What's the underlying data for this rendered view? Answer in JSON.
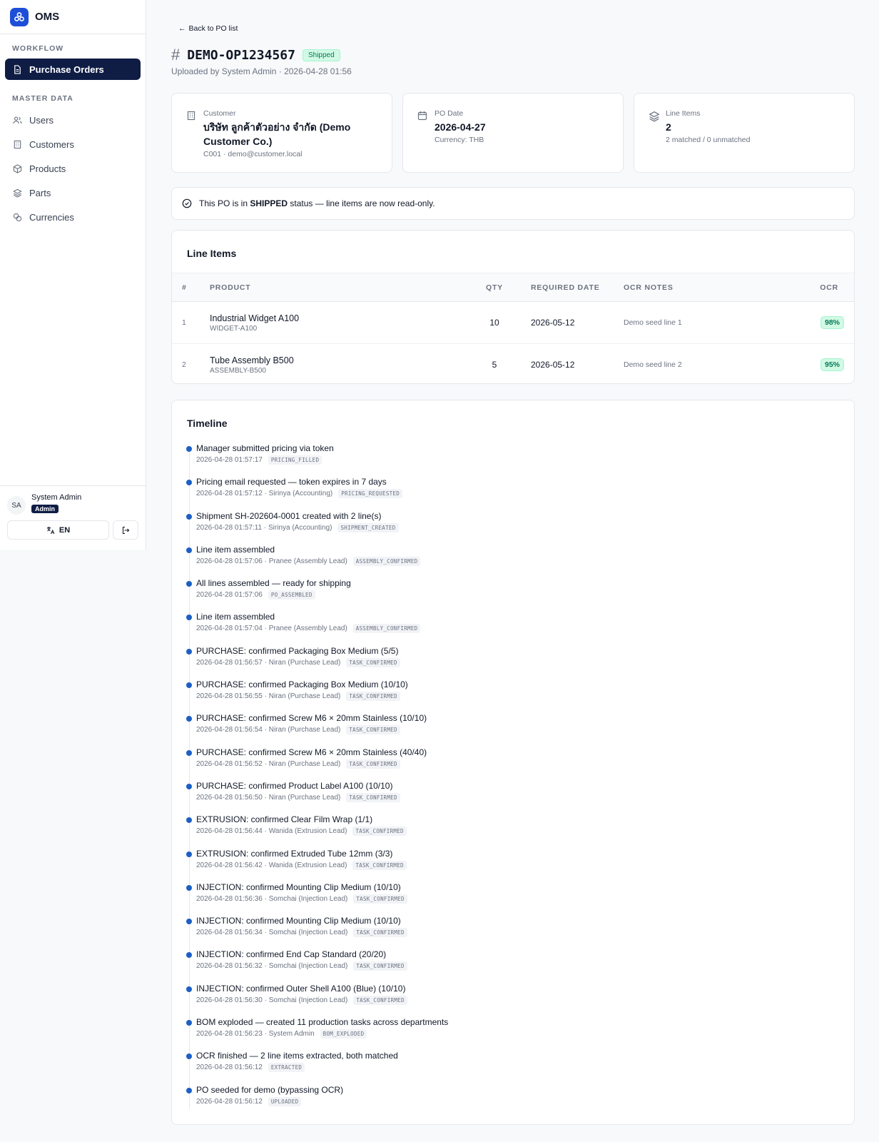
{
  "app": {
    "name": "OMS"
  },
  "sidebar": {
    "workflow_label": "WORKFLOW",
    "workflow_items": [
      {
        "label": "Purchase Orders",
        "icon": "file-icon"
      }
    ],
    "master_label": "MASTER DATA",
    "master_items": [
      {
        "label": "Users",
        "icon": "users-icon"
      },
      {
        "label": "Customers",
        "icon": "building-icon"
      },
      {
        "label": "Products",
        "icon": "box-icon"
      },
      {
        "label": "Parts",
        "icon": "layers-icon"
      },
      {
        "label": "Currencies",
        "icon": "coins-icon"
      }
    ],
    "user": {
      "initials": "SA",
      "name": "System Admin",
      "role": "Admin"
    },
    "lang": "EN"
  },
  "header": {
    "back_label": "Back to PO list",
    "po_number": "DEMO-OP1234567",
    "status": "Shipped",
    "uploaded": "Uploaded by System Admin · 2026-04-28 01:56"
  },
  "cards": {
    "customer": {
      "label": "Customer",
      "value": "บริษัท ลูกค้าตัวอย่าง จำกัด (Demo Customer Co.)",
      "sub": "C001 · demo@customer.local"
    },
    "po_date": {
      "label": "PO Date",
      "value": "2026-04-27",
      "sub": "Currency: THB"
    },
    "line_items": {
      "label": "Line Items",
      "value": "2",
      "sub": "2 matched / 0 unmatched"
    }
  },
  "alert": {
    "prefix": "This PO is in ",
    "status": "SHIPPED",
    "suffix": " status — line items are now read-only."
  },
  "line_items": {
    "title": "Line Items",
    "columns": [
      "#",
      "PRODUCT",
      "QTY",
      "REQUIRED DATE",
      "OCR NOTES",
      "OCR"
    ],
    "rows": [
      {
        "num": "1",
        "name": "Industrial Widget A100",
        "sku": "WIDGET-A100",
        "qty": "10",
        "date": "2026-05-12",
        "notes": "Demo seed line 1",
        "ocr": "98%"
      },
      {
        "num": "2",
        "name": "Tube Assembly B500",
        "sku": "ASSEMBLY-B500",
        "qty": "5",
        "date": "2026-05-12",
        "notes": "Demo seed line 2",
        "ocr": "95%"
      }
    ]
  },
  "timeline": {
    "title": "Timeline",
    "events": [
      {
        "text": "Manager submitted pricing via token",
        "meta": "2026-04-28 01:57:17",
        "code": "PRICING_FILLED"
      },
      {
        "text": "Pricing email requested — token expires in 7 days",
        "meta": "2026-04-28 01:57:12 · Sirinya (Accounting)",
        "code": "PRICING_REQUESTED"
      },
      {
        "text": "Shipment SH-202604-0001 created with 2 line(s)",
        "meta": "2026-04-28 01:57:11 · Sirinya (Accounting)",
        "code": "SHIPMENT_CREATED"
      },
      {
        "text": "Line item assembled",
        "meta": "2026-04-28 01:57:06 · Pranee (Assembly Lead)",
        "code": "ASSEMBLY_CONFIRMED"
      },
      {
        "text": "All lines assembled — ready for shipping",
        "meta": "2026-04-28 01:57:06",
        "code": "PO_ASSEMBLED"
      },
      {
        "text": "Line item assembled",
        "meta": "2026-04-28 01:57:04 · Pranee (Assembly Lead)",
        "code": "ASSEMBLY_CONFIRMED"
      },
      {
        "text": "PURCHASE: confirmed Packaging Box Medium (5/5)",
        "meta": "2026-04-28 01:56:57 · Niran (Purchase Lead)",
        "code": "TASK_CONFIRMED"
      },
      {
        "text": "PURCHASE: confirmed Packaging Box Medium (10/10)",
        "meta": "2026-04-28 01:56:55 · Niran (Purchase Lead)",
        "code": "TASK_CONFIRMED"
      },
      {
        "text": "PURCHASE: confirmed Screw M6 × 20mm Stainless (10/10)",
        "meta": "2026-04-28 01:56:54 · Niran (Purchase Lead)",
        "code": "TASK_CONFIRMED"
      },
      {
        "text": "PURCHASE: confirmed Screw M6 × 20mm Stainless (40/40)",
        "meta": "2026-04-28 01:56:52 · Niran (Purchase Lead)",
        "code": "TASK_CONFIRMED"
      },
      {
        "text": "PURCHASE: confirmed Product Label A100 (10/10)",
        "meta": "2026-04-28 01:56:50 · Niran (Purchase Lead)",
        "code": "TASK_CONFIRMED"
      },
      {
        "text": "EXTRUSION: confirmed Clear Film Wrap (1/1)",
        "meta": "2026-04-28 01:56:44 · Wanida (Extrusion Lead)",
        "code": "TASK_CONFIRMED"
      },
      {
        "text": "EXTRUSION: confirmed Extruded Tube 12mm (3/3)",
        "meta": "2026-04-28 01:56:42 · Wanida (Extrusion Lead)",
        "code": "TASK_CONFIRMED"
      },
      {
        "text": "INJECTION: confirmed Mounting Clip Medium (10/10)",
        "meta": "2026-04-28 01:56:36 · Somchai (Injection Lead)",
        "code": "TASK_CONFIRMED"
      },
      {
        "text": "INJECTION: confirmed Mounting Clip Medium (10/10)",
        "meta": "2026-04-28 01:56:34 · Somchai (Injection Lead)",
        "code": "TASK_CONFIRMED"
      },
      {
        "text": "INJECTION: confirmed End Cap Standard (20/20)",
        "meta": "2026-04-28 01:56:32 · Somchai (Injection Lead)",
        "code": "TASK_CONFIRMED"
      },
      {
        "text": "INJECTION: confirmed Outer Shell A100 (Blue) (10/10)",
        "meta": "2026-04-28 01:56:30 · Somchai (Injection Lead)",
        "code": "TASK_CONFIRMED"
      },
      {
        "text": "BOM exploded — created 11 production tasks across departments",
        "meta": "2026-04-28 01:56:23 · System Admin",
        "code": "BOM_EXPLODED"
      },
      {
        "text": "OCR finished — 2 line items extracted, both matched",
        "meta": "2026-04-28 01:56:12",
        "code": "EXTRACTED"
      },
      {
        "text": "PO seeded for demo (bypassing OCR)",
        "meta": "2026-04-28 01:56:12",
        "code": "UPLOADED"
      }
    ]
  },
  "colors": {
    "accent": "#1d5fc4",
    "nav_active": "#0f1d45",
    "success": "#047857"
  }
}
